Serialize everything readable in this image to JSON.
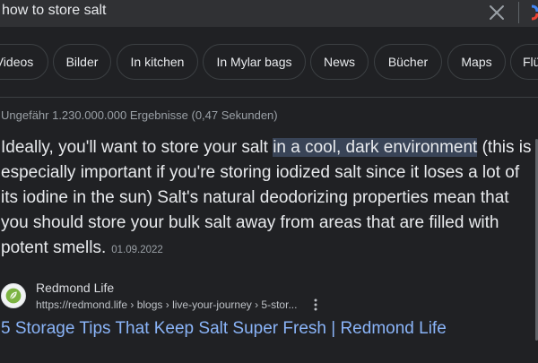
{
  "search": {
    "query": "how to store salt",
    "clear_icon": "close-icon"
  },
  "chips": [
    {
      "label": "Videos"
    },
    {
      "label": "Bilder"
    },
    {
      "label": "In kitchen"
    },
    {
      "label": "In Mylar bags"
    },
    {
      "label": "News"
    },
    {
      "label": "Bücher"
    },
    {
      "label": "Maps"
    },
    {
      "label": "Flü"
    }
  ],
  "results_stats": "Ungefähr 1.230.000.000 Ergebnisse (0,47 Sekunden)",
  "snippet": {
    "before": "Ideally, you'll want to store your salt ",
    "highlight": "in a cool, dark environment",
    "after": " (this is especially important if you're storing iodized salt since it loses a lot of its iodine in the sun) Salt's natural deodorizing properties mean that you should store your bulk salt away from areas that are filled with potent smells.",
    "date": "01.09.2022"
  },
  "result": {
    "site_name": "Redmond Life",
    "url": "https://redmond.life › blogs › live-your-journey › 5-stor...",
    "title": "5 Storage Tips That Keep Salt Super Fresh | Redmond Life",
    "favicon_icon": "leaf-icon",
    "more_icon": "more-vertical-icon"
  },
  "colors": {
    "background": "#202124",
    "link": "#8ab4f8",
    "highlight": "#394457",
    "secondary_text": "#9aa0a6"
  }
}
